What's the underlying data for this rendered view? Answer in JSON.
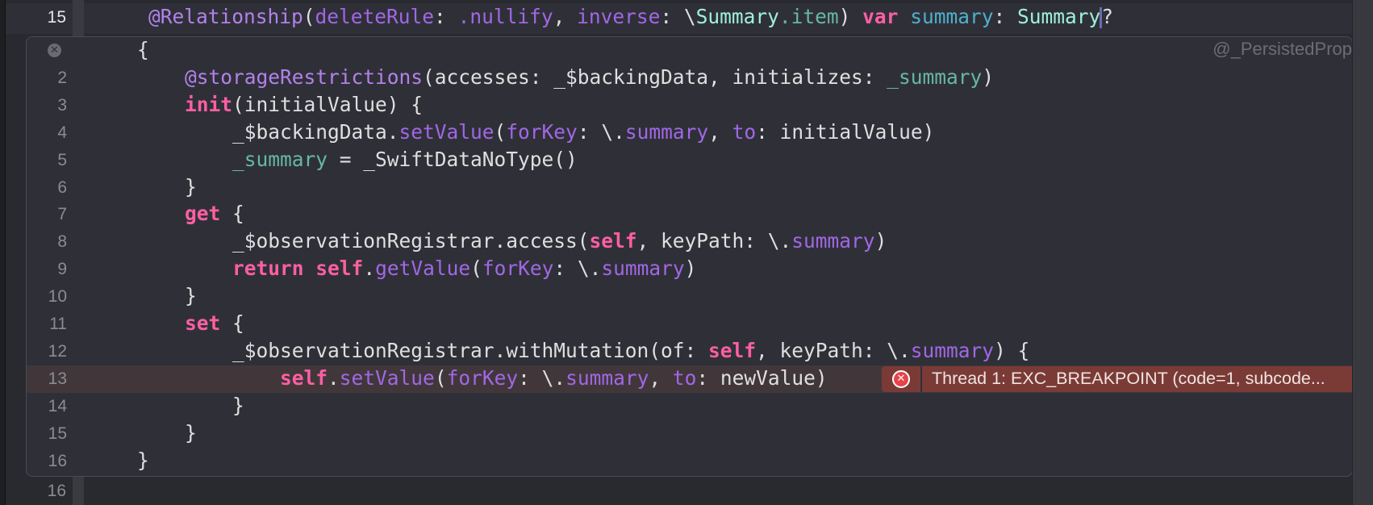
{
  "editor": {
    "top_line": {
      "number": "15",
      "tokens": [
        [
          "attr",
          "@Relationship"
        ],
        [
          "",
          "("
        ],
        [
          "prop",
          "deleteRule"
        ],
        [
          "",
          ": "
        ],
        [
          "prop",
          ".nullify"
        ],
        [
          "",
          ", "
        ],
        [
          "prop",
          "inverse"
        ],
        [
          "",
          ": \\"
        ],
        [
          "type",
          "Summary"
        ],
        [
          "",
          ""
        ],
        [
          "decl",
          ".item"
        ],
        [
          "",
          ") "
        ],
        [
          "kw",
          "var"
        ],
        [
          "",
          ""
        ],
        [
          "var",
          " summary"
        ],
        [
          "",
          ": "
        ],
        [
          "type",
          "Summary"
        ],
        [
          "cursor",
          ""
        ],
        [
          "",
          "?"
        ]
      ]
    },
    "bottom_line": {
      "number": "16"
    }
  },
  "expansion": {
    "close_icon": "close-icon",
    "macro_label": "@_PersistedProp",
    "lines": [
      {
        "number": "",
        "tokens": [
          [
            "",
            "{"
          ]
        ]
      },
      {
        "number": "2",
        "tokens": [
          [
            "",
            "    "
          ],
          [
            "attr",
            "@storageRestrictions"
          ],
          [
            "",
            "(accesses: _$backingData, initializes: "
          ],
          [
            "decl",
            "_summary"
          ],
          [
            "",
            ")"
          ]
        ]
      },
      {
        "number": "3",
        "tokens": [
          [
            "",
            "    "
          ],
          [
            "kw",
            "init"
          ],
          [
            "",
            "(initialValue) {"
          ]
        ]
      },
      {
        "number": "4",
        "tokens": [
          [
            "",
            "        _$backingData."
          ],
          [
            "prop",
            "setValue"
          ],
          [
            "",
            "("
          ],
          [
            "prop",
            "forKey"
          ],
          [
            "",
            ": \\."
          ],
          [
            "prop",
            "summary"
          ],
          [
            "",
            ", "
          ],
          [
            "prop",
            "to"
          ],
          [
            "",
            ": initialValue)"
          ]
        ]
      },
      {
        "number": "5",
        "tokens": [
          [
            "",
            "        "
          ],
          [
            "decl",
            "_summary"
          ],
          [
            "",
            " = _SwiftDataNoType()"
          ]
        ]
      },
      {
        "number": "6",
        "tokens": [
          [
            "",
            "    }"
          ]
        ]
      },
      {
        "number": "7",
        "tokens": [
          [
            "",
            "    "
          ],
          [
            "kw",
            "get"
          ],
          [
            "",
            " {"
          ]
        ]
      },
      {
        "number": "8",
        "tokens": [
          [
            "",
            "        _$observationRegistrar.access("
          ],
          [
            "kw",
            "self"
          ],
          [
            "",
            ", keyPath: \\."
          ],
          [
            "prop",
            "summary"
          ],
          [
            "",
            ")"
          ]
        ]
      },
      {
        "number": "9",
        "tokens": [
          [
            "",
            "        "
          ],
          [
            "kw",
            "return"
          ],
          [
            "",
            " "
          ],
          [
            "kw",
            "self"
          ],
          [
            "",
            "."
          ],
          [
            "prop",
            "getValue"
          ],
          [
            "",
            "("
          ],
          [
            "prop",
            "forKey"
          ],
          [
            "",
            ": \\."
          ],
          [
            "prop",
            "summary"
          ],
          [
            "",
            ")"
          ]
        ]
      },
      {
        "number": "10",
        "tokens": [
          [
            "",
            "    }"
          ]
        ]
      },
      {
        "number": "11",
        "tokens": [
          [
            "",
            "    "
          ],
          [
            "kw",
            "set"
          ],
          [
            "",
            " {"
          ]
        ]
      },
      {
        "number": "12",
        "tokens": [
          [
            "",
            "        _$observationRegistrar.withMutation(of: "
          ],
          [
            "kw",
            "self"
          ],
          [
            "",
            ", keyPath: \\."
          ],
          [
            "prop",
            "summary"
          ],
          [
            "",
            ") {"
          ]
        ]
      },
      {
        "number": "13",
        "tokens": [
          [
            "",
            "            "
          ],
          [
            "kw",
            "self"
          ],
          [
            "",
            "."
          ],
          [
            "prop",
            "setValue"
          ],
          [
            "",
            "("
          ],
          [
            "prop",
            "forKey"
          ],
          [
            "",
            ": \\."
          ],
          [
            "prop",
            "summary"
          ],
          [
            "",
            ", "
          ],
          [
            "prop",
            "to"
          ],
          [
            "",
            ": newValue)"
          ]
        ],
        "highlight": true
      },
      {
        "number": "14",
        "tokens": [
          [
            "",
            "        }"
          ]
        ]
      },
      {
        "number": "15",
        "tokens": [
          [
            "",
            "    }"
          ]
        ]
      },
      {
        "number": "16",
        "tokens": [
          [
            "",
            "}"
          ]
        ]
      }
    ]
  },
  "error": {
    "icon": "error-x-icon",
    "message": "Thread 1: EXC_BREAKPOINT (code=1, subcode...",
    "color": "#7a3b36"
  }
}
